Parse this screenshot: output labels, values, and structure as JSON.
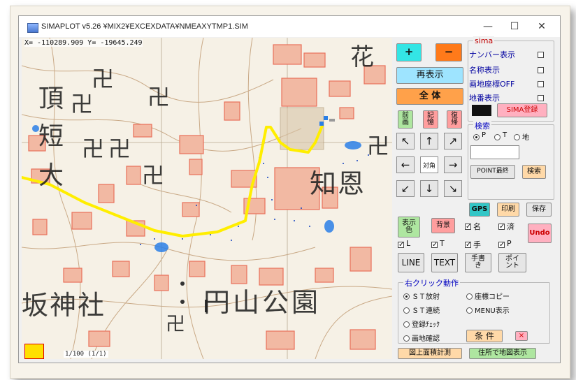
{
  "window": {
    "title": "SIMAPLOT v5.26 ¥MIX2¥EXCEXDATA¥NMEAXYTMP1.SIM",
    "minimize": "—",
    "maximize": "☐",
    "close": "✕"
  },
  "map": {
    "coord_readout": "X= -110289.909 Y= -19645.249",
    "labels": [
      {
        "text": "花"
      },
      {
        "text": "卍"
      },
      {
        "text": "卍"
      },
      {
        "text": "卍"
      },
      {
        "text": "卍"
      },
      {
        "text": "卍"
      },
      {
        "text": "卍"
      },
      {
        "text": "卍"
      },
      {
        "text": "頂"
      },
      {
        "text": "短"
      },
      {
        "text": "大"
      },
      {
        "text": "知恩"
      },
      {
        "text": "坂神社"
      },
      {
        "text": "円山公園"
      },
      {
        "text": "卍"
      }
    ],
    "scale_label": "1/100 (1/1)"
  },
  "panel": {
    "zoom_in": "+",
    "zoom_out": "−",
    "redraw": "再表示",
    "whole": "全 体",
    "prev_screen": "前\n画",
    "memory": "記\n憶",
    "restore": "復\n帰",
    "arrows": {
      "nw": "↖",
      "n": "↑",
      "ne": "↗",
      "w": "←",
      "center": "対角",
      "e": "→",
      "sw": "↙",
      "s": "↓",
      "se": "↘"
    },
    "sima": {
      "legend": "sima",
      "number_display": "ナンバー表示",
      "name_display": "名称表示",
      "coord_off": "画地座標OFF",
      "lot_display": "地番表示",
      "register": "SIMA登録"
    },
    "search": {
      "legend": "検索",
      "opt_p": "P",
      "opt_t": "T",
      "opt_ground": "地",
      "point_recent": "POINT最終",
      "search_btn": "検索"
    },
    "gps": "GPS",
    "print": "印刷",
    "save": "保存",
    "display_color": "表示\n色",
    "background": "背景",
    "undo": "Undo",
    "checks": {
      "name": "名",
      "done": "済",
      "l": "L",
      "t": "T",
      "hand": "手",
      "p": "P"
    },
    "line": "LINE",
    "text": "TEXT",
    "handwrite": "手書\nき",
    "point": "ポイ\nント",
    "right_click": {
      "legend": "右クリック動作",
      "st_radial": "ＳＴ放射",
      "coord_copy": "座標コピー",
      "st_continuous": "ＳＴ連続",
      "menu_display": "MENU表示",
      "register_check": "登録ﾁｪｯｸ",
      "lot_confirm": "画地確認",
      "condition": "条 件",
      "x": "×"
    },
    "area_measure": "図上面積計測",
    "address_map": "住所で地図表示"
  },
  "colors": {
    "zoom_in_bg": "#33e5e5",
    "zoom_out_bg": "#ff7a1a",
    "redraw_bg": "#9ee4ff",
    "whole_bg": "#ffa14a",
    "route": "#ffee00",
    "building": "#f2b9a3",
    "building_edge": "#e8705a",
    "water": "#2a7fe6",
    "gps_bg": "#33c6c6"
  }
}
